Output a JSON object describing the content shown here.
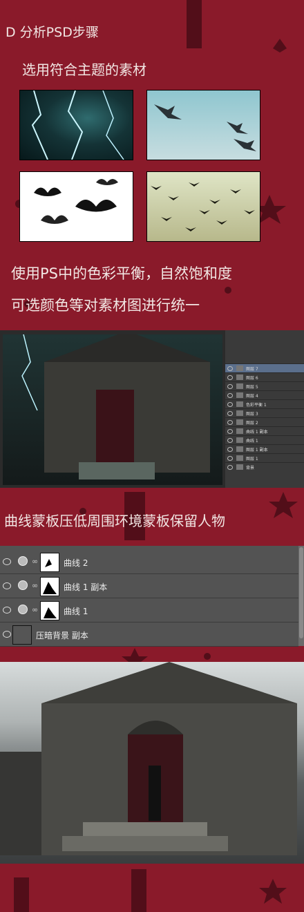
{
  "section": {
    "heading": "D 分析PSD步骤",
    "subheading": "选用符合主题的素材",
    "caption_line1": "使用PS中的色彩平衡，自然饱和度",
    "caption_line2": "可选颜色等对素材图进行统一",
    "curves_caption": "曲线蒙板压低周围环境蒙板保留人物"
  },
  "ps_panel": {
    "rows": [
      "图层 7",
      "图层 6",
      "图层 5",
      "图层 4",
      "色彩平衡 1",
      "图层 3",
      "图层 2",
      "曲线 1 副本",
      "曲线 1",
      "图层 1 副本",
      "图层 1",
      "背景"
    ]
  },
  "layers": {
    "rows": [
      {
        "label": "曲线 2"
      },
      {
        "label": "曲线 1 副本"
      },
      {
        "label": "曲线 1"
      },
      {
        "label": "压暗背景 副本"
      }
    ]
  },
  "colors": {
    "background": "#8a1a2a",
    "pattern": "#3a0a12",
    "text": "#f2e7e4"
  }
}
